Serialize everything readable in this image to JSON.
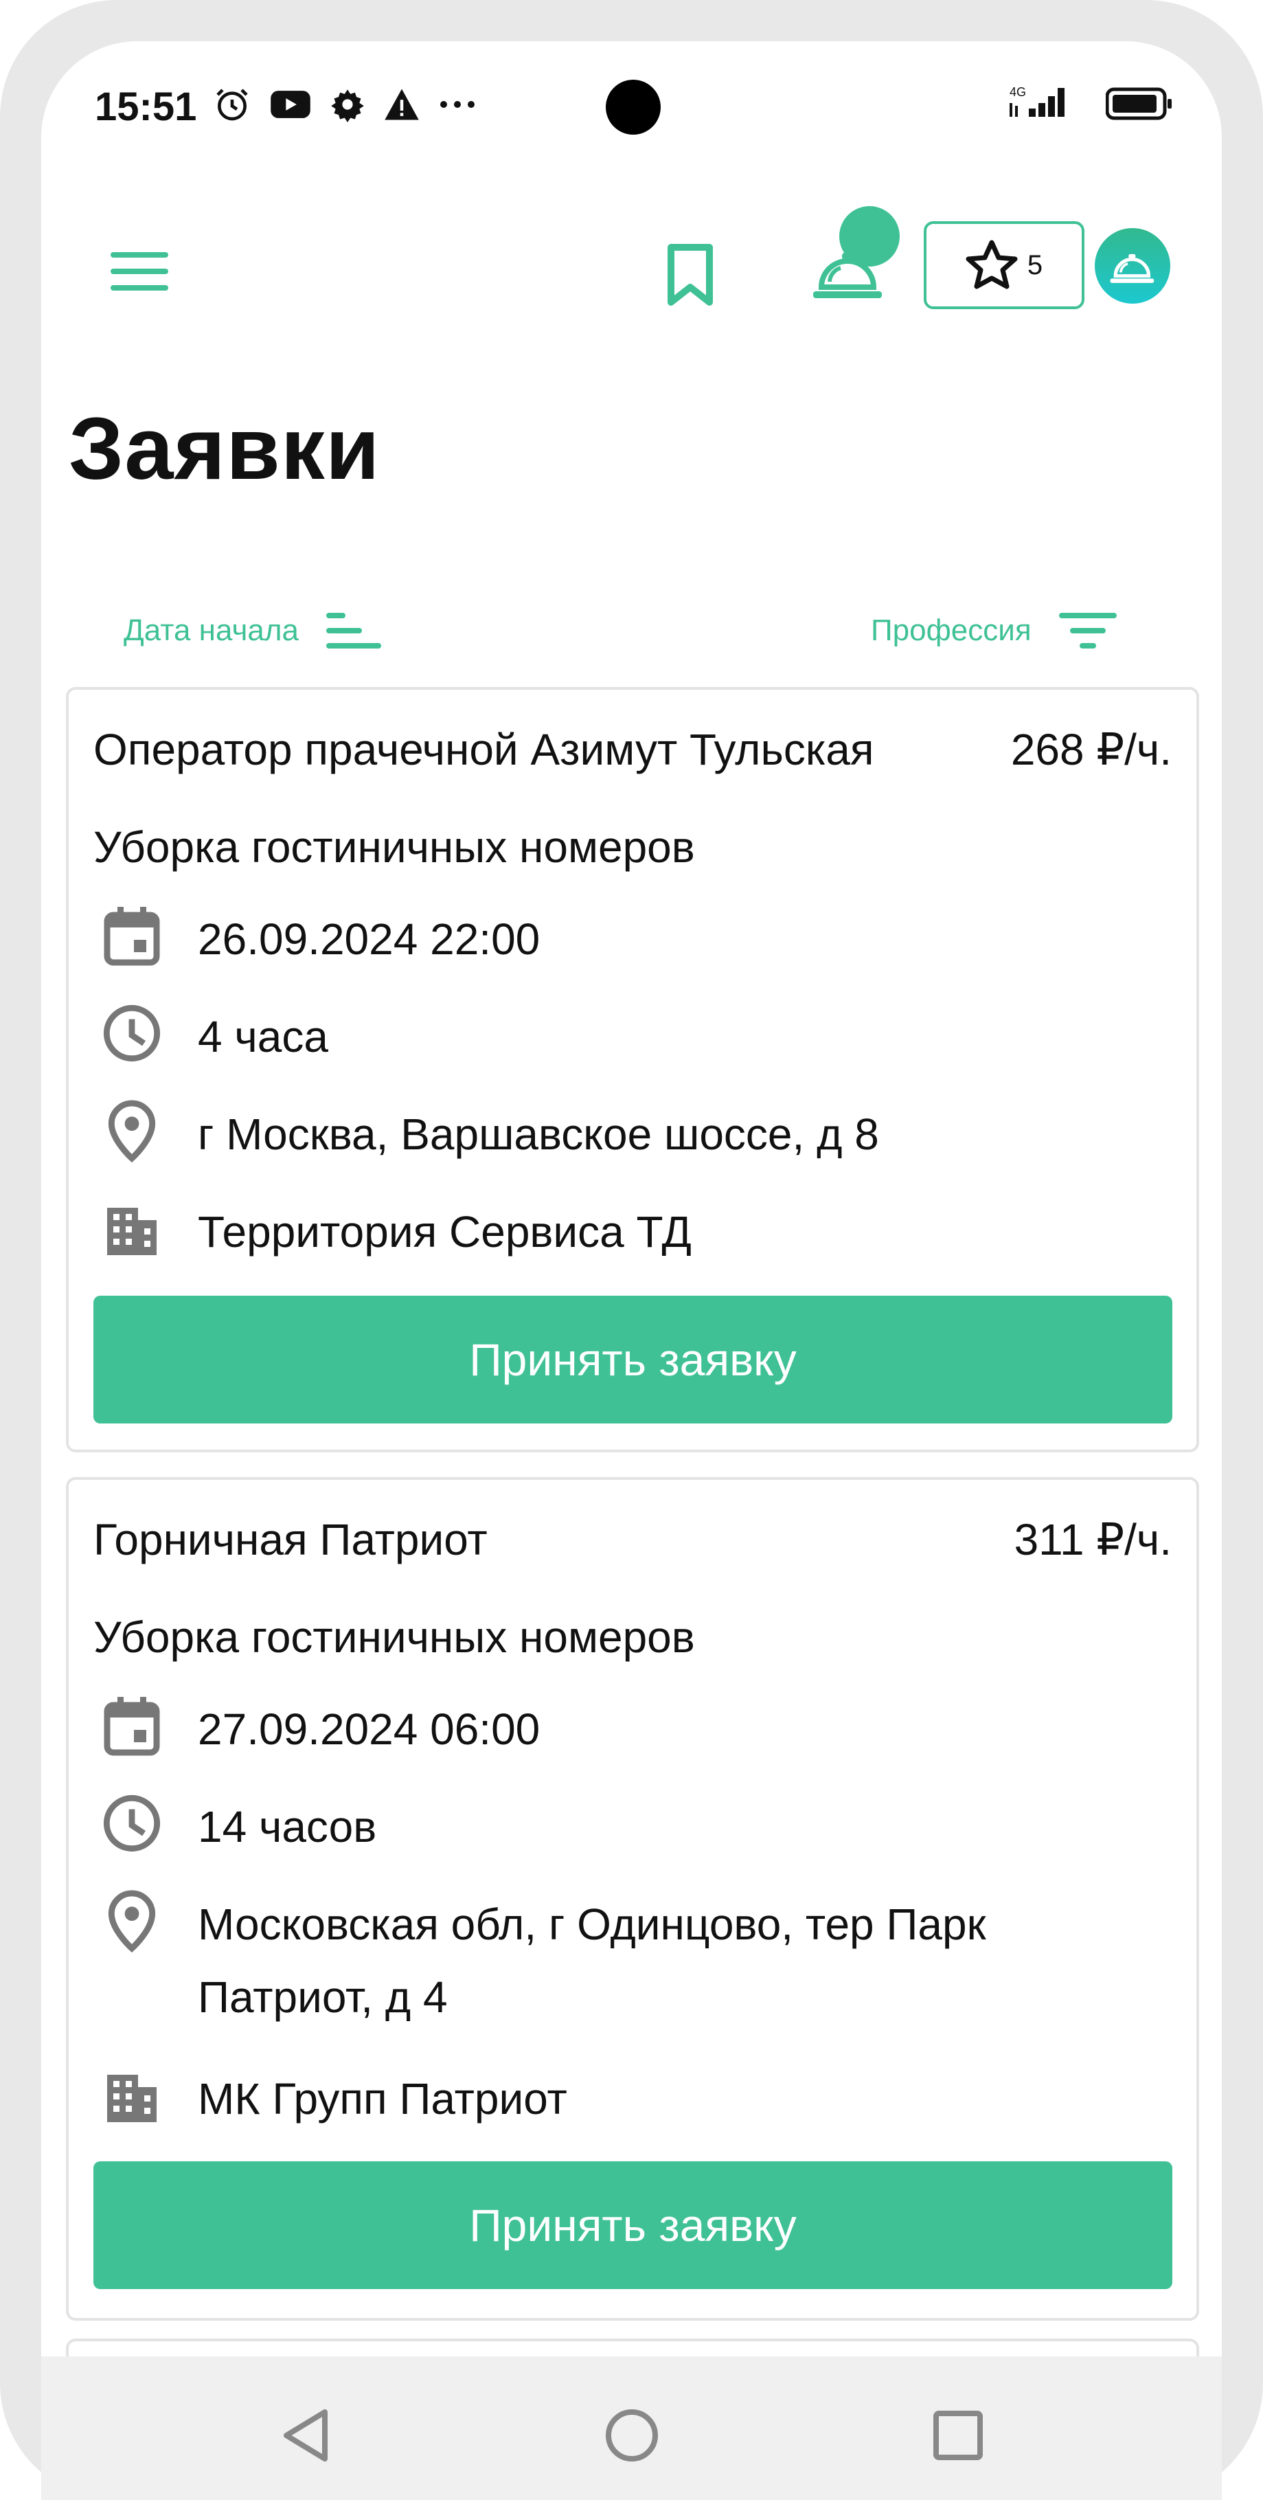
{
  "status_bar": {
    "time": "15:51",
    "network": "4G"
  },
  "header": {
    "favorites_count": "5",
    "accent_color": "#3fc195"
  },
  "page": {
    "title": "Заявки"
  },
  "sort": {
    "date_label": "Дата начала",
    "profession_label": "Профессия"
  },
  "cards": [
    {
      "title": "Оператор прачечной Азимут Тульская",
      "price": "268 ₽/ч.",
      "subtitle": "Уборка гостиничных номеров",
      "date": "26.09.2024 22:00",
      "duration": "4 часа",
      "address": "г Москва, Варшавское шоссе, д 8",
      "company": "Территория Сервиса ТД",
      "button": "Принять заявку"
    },
    {
      "title": "Горничная Патриот",
      "price": "311 ₽/ч.",
      "subtitle": "Уборка гостиничных номеров",
      "date": "27.09.2024 06:00",
      "duration": "14 часов",
      "address": "Московская обл, г Одинцово, тер Парк Патриот, д 4",
      "company": "МК Групп Патриот",
      "button": "Принять заявку"
    }
  ],
  "icons": {
    "menu": "menu-icon",
    "bookmark": "bookmark-icon",
    "bell": "service-bell-icon",
    "star": "star-icon",
    "avatar": "service-bell-avatar-icon",
    "calendar": "calendar-icon",
    "clock": "clock-icon",
    "location": "location-pin-icon",
    "building": "building-icon"
  }
}
